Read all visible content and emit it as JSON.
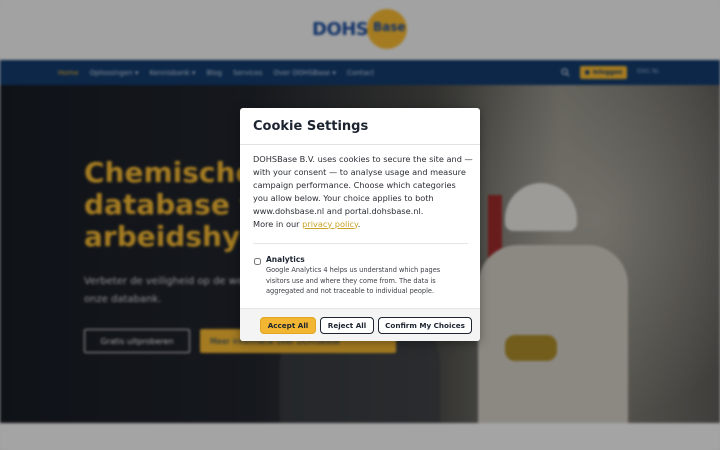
{
  "site": {
    "logo_main": "DOHS",
    "logo_badge": "Base"
  },
  "nav": {
    "items": [
      {
        "label": "Home",
        "active": true
      },
      {
        "label": "Oplossingen ▾",
        "active": false
      },
      {
        "label": "Kennisbank ▾",
        "active": false
      },
      {
        "label": "Blog",
        "active": false
      },
      {
        "label": "Services",
        "active": false
      },
      {
        "label": "Over DOHSBase ▾",
        "active": false
      },
      {
        "label": "Contact",
        "active": false
      }
    ],
    "login_label": "Inloggen",
    "language": "ENG NL"
  },
  "hero": {
    "headline_line1": "Chemische",
    "headline_line2": "database v",
    "headline_line3": "arbeidshyg",
    "subtitle": "Verbeter de veiligheid op de werkvloer met onze databank.",
    "button_primary": "Gratis uitproberen",
    "button_secondary": "Meer informatie over DOHSBase"
  },
  "cookie_modal": {
    "title": "Cookie Settings",
    "body": "DOHSBase B.V. uses cookies to secure the site and — with your consent — to analyse usage and measure campaign performance. Choose which categories you allow below. Your choice applies to both www.dohsbase.nl and portal.dohsbase.nl.",
    "more_prefix": "More in our ",
    "privacy_link": "privacy policy",
    "more_suffix": ".",
    "analytics_title": "Analytics",
    "analytics_desc": "Google Analytics 4 helps us understand which pages visitors use and where they come from. The data is aggregated and not traceable to individual people.",
    "analytics_checked": false,
    "buttons": {
      "accept_all": "Accept All",
      "reject_all": "Reject All",
      "confirm": "Confirm My Choices"
    }
  },
  "colors": {
    "brand_navy": "#123a6b",
    "brand_yellow": "#f2b632",
    "link": "#c9a227"
  }
}
